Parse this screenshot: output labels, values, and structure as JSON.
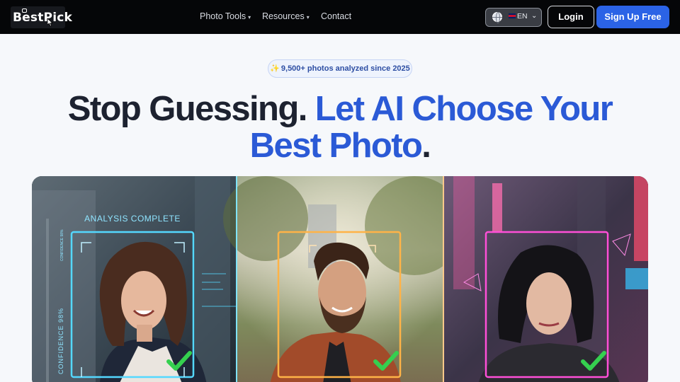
{
  "nav": {
    "logo": "BestPick",
    "menu": [
      {
        "label": "Photo Tools",
        "caret": "▾"
      },
      {
        "label": "Resources",
        "caret": "▾"
      },
      {
        "label": "Contact",
        "caret": ""
      }
    ],
    "language": {
      "label": "EN",
      "chevron": "⌄"
    },
    "login": "Login",
    "signup": "Sign Up Free"
  },
  "hero": {
    "badge_icon": "✨",
    "badge": "9,500+ photos analyzed since 2025",
    "headline_dark": "Stop Guessing.",
    "headline_blue_1": "Let AI Choose Your",
    "headline_blue_2": "Best Photo",
    "headline_period": "."
  },
  "showcase": {
    "analysis_label": "ANALYSIS COMPLETE",
    "confidence_small": "CONFIDENCE 98%",
    "confidence_large": "CONFIDENCE 98%",
    "accent_colors": {
      "cyan": "#54d8ff",
      "gold": "#ffb347",
      "magenta": "#ff4fd8",
      "check": "#35d04f"
    }
  }
}
